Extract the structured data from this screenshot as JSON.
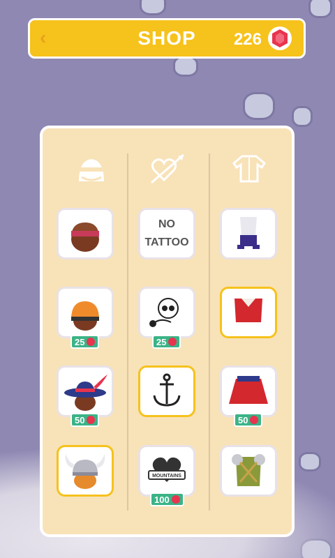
{
  "header": {
    "back_label": "‹",
    "title": "SHOP",
    "gem_count": "226"
  },
  "colors": {
    "header": "#f6c21c",
    "panel": "#f8e2b8",
    "price": "#3bb387",
    "gem": "#e8344e"
  },
  "categories": [
    {
      "name": "headwear",
      "icon": "head-icon"
    },
    {
      "name": "tattoo",
      "icon": "heart-arrow-icon"
    },
    {
      "name": "outfit",
      "icon": "shirt-icon"
    }
  ],
  "items": {
    "no_tattoo_line1": "NO",
    "no_tattoo_line2": "TATTOO",
    "prices": {
      "helmet": "25",
      "skull": "25",
      "feather_hat": "50",
      "cape": "50",
      "mountains": "100"
    },
    "mountains_banner": "MOUNTAINS"
  }
}
